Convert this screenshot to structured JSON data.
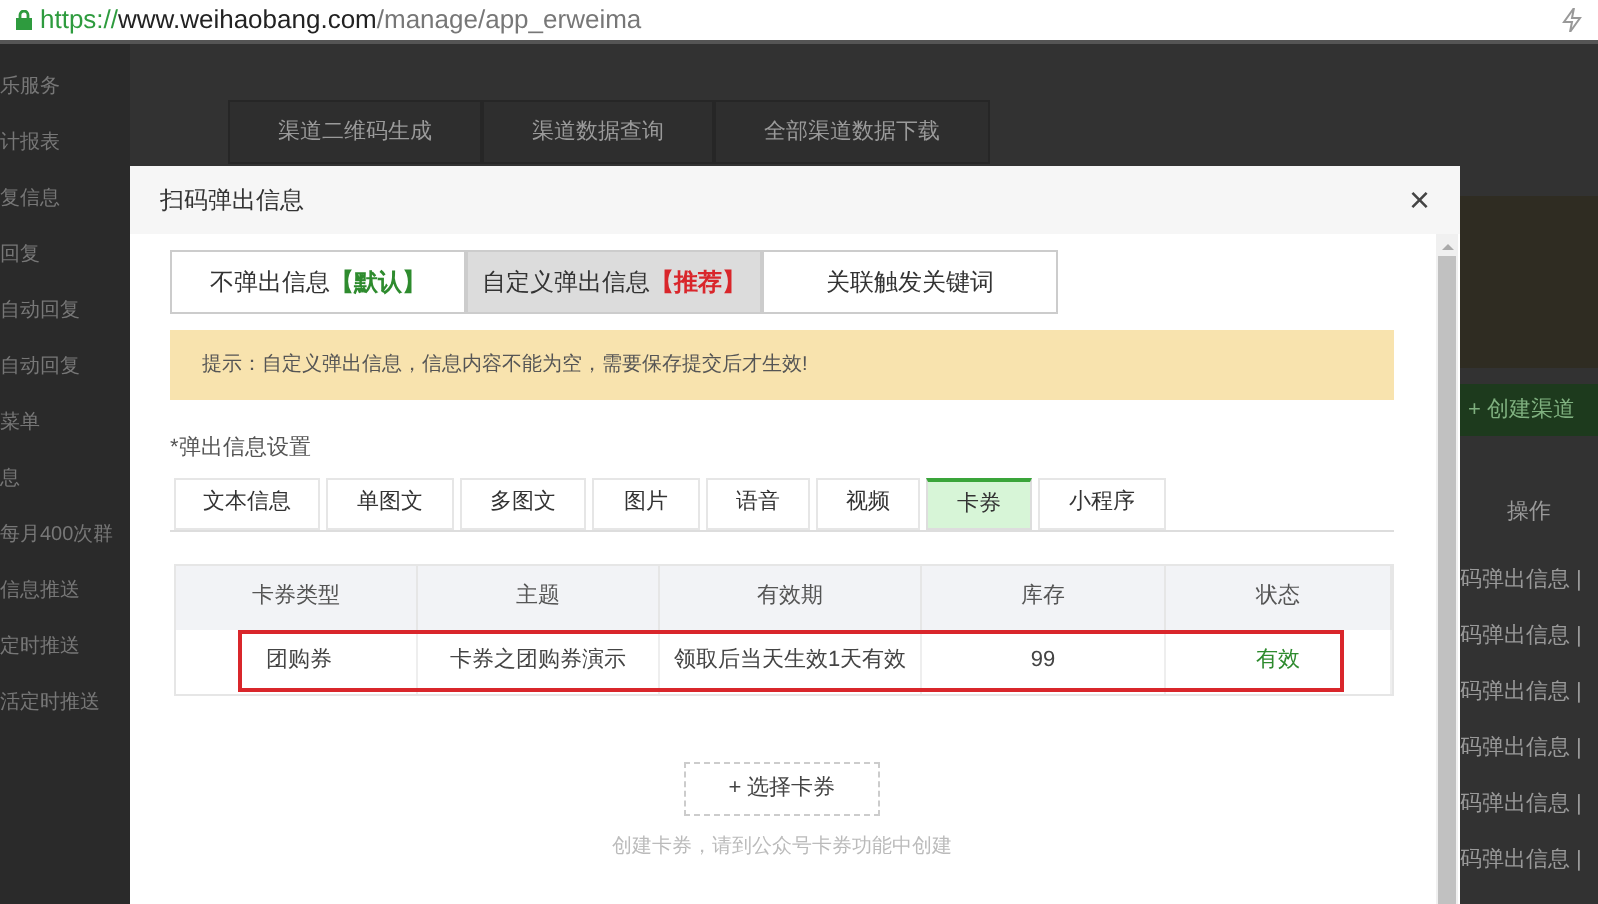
{
  "address_bar": {
    "scheme": "https://",
    "host": "www.weihaobang.com",
    "path": "/manage/app_erweima"
  },
  "sidebar": {
    "items": [
      "乐服务",
      "计报表",
      "复信息",
      "回复",
      "自动回复",
      "自动回复",
      "菜单",
      "息",
      "每月400次群",
      "信息推送",
      "定时推送",
      "活定时推送"
    ]
  },
  "background_tabs": [
    "渠道二维码生成",
    "渠道数据查询",
    "全部渠道数据下载"
  ],
  "background_panel": {
    "create_button": "+ 创建渠道",
    "column_header": "操作",
    "row_actions": [
      "码弹出信息 |",
      "码弹出信息 |",
      "码弹出信息 |",
      "码弹出信息 |",
      "码弹出信息 |",
      "码弹出信息 |"
    ]
  },
  "dialog": {
    "title": "扫码弹出信息",
    "close": "×",
    "mode_tabs": [
      {
        "label": "不弹出信息",
        "kind": "default",
        "tag": "【默认】",
        "selected": false
      },
      {
        "label": "自定义弹出信息",
        "kind": "recommended",
        "tag": "【推荐】",
        "selected": true
      },
      {
        "label": "关联触发关键词",
        "selected": false
      }
    ],
    "notice": "提示：自定义弹出信息，信息内容不能为空，需要保存提交后才生效!",
    "section_label": "*弹出信息设置",
    "type_tabs": [
      {
        "label": "文本信息",
        "selected": false
      },
      {
        "label": "单图文",
        "selected": false
      },
      {
        "label": "多图文",
        "selected": false
      },
      {
        "label": "图片",
        "selected": false
      },
      {
        "label": "语音",
        "selected": false
      },
      {
        "label": "视频",
        "selected": false
      },
      {
        "label": "卡券",
        "selected": true
      },
      {
        "label": "小程序",
        "selected": false
      }
    ],
    "table": {
      "columns": [
        "卡券类型",
        "主题",
        "有效期",
        "库存",
        "状态"
      ],
      "rows": [
        {
          "cells": [
            "团购券",
            "卡券之团购券演示",
            "领取后当天生效1天有效",
            "99",
            "有效"
          ],
          "highlighted": true
        }
      ]
    },
    "add_button": "+ 选择卡券",
    "hint": "创建卡券，请到公众号卡券功能中创建"
  }
}
